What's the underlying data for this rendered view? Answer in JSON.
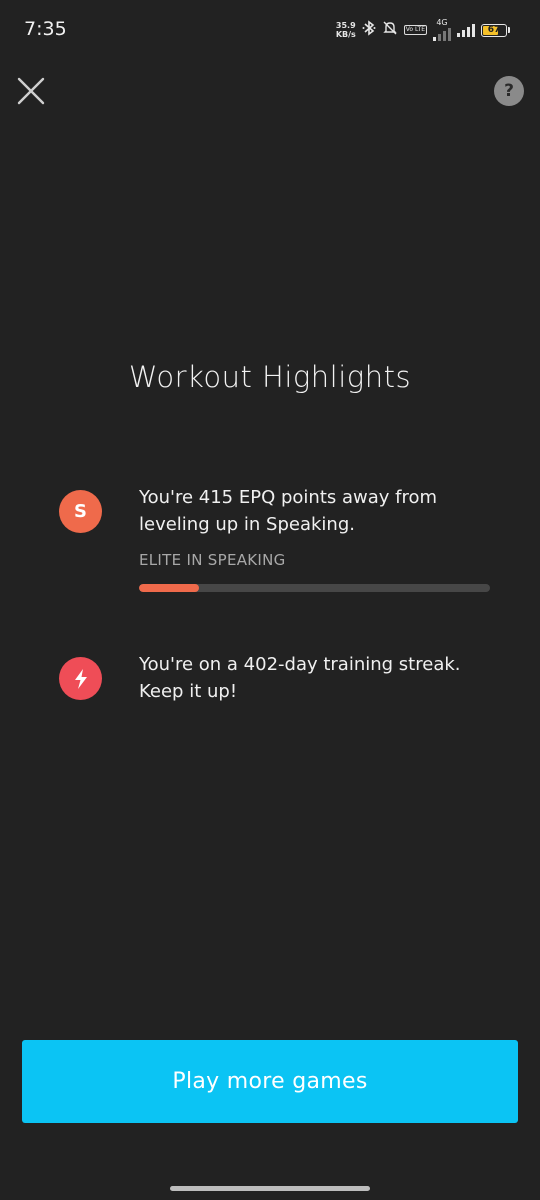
{
  "status_bar": {
    "time": "7:35",
    "net_speed_value": "35.9",
    "net_speed_unit": "KB/s",
    "volte_label": "Vo LTE",
    "network_type": "4G",
    "battery_level": "67",
    "icons": [
      "bluetooth-icon",
      "mute-icon",
      "volte-icon",
      "signal-icon",
      "battery-icon"
    ]
  },
  "header": {
    "close_icon": "close-icon",
    "help_label": "?"
  },
  "main": {
    "title": "Workout Highlights",
    "highlights": [
      {
        "icon_letter": "S",
        "icon_color": "#ef6a4b",
        "text": "You're 415 EPQ points away from leveling up in Speaking.",
        "progress_label": "ELITE IN SPEAKING",
        "progress_fraction": 0.17,
        "progress_color": "#ef6a4b"
      },
      {
        "icon": "lightning-icon",
        "icon_color": "#ef4d57",
        "text": "You're on a 402-day training streak. Keep it up!"
      }
    ]
  },
  "footer": {
    "cta_label": "Play more games",
    "cta_color": "#0bc4f4"
  }
}
